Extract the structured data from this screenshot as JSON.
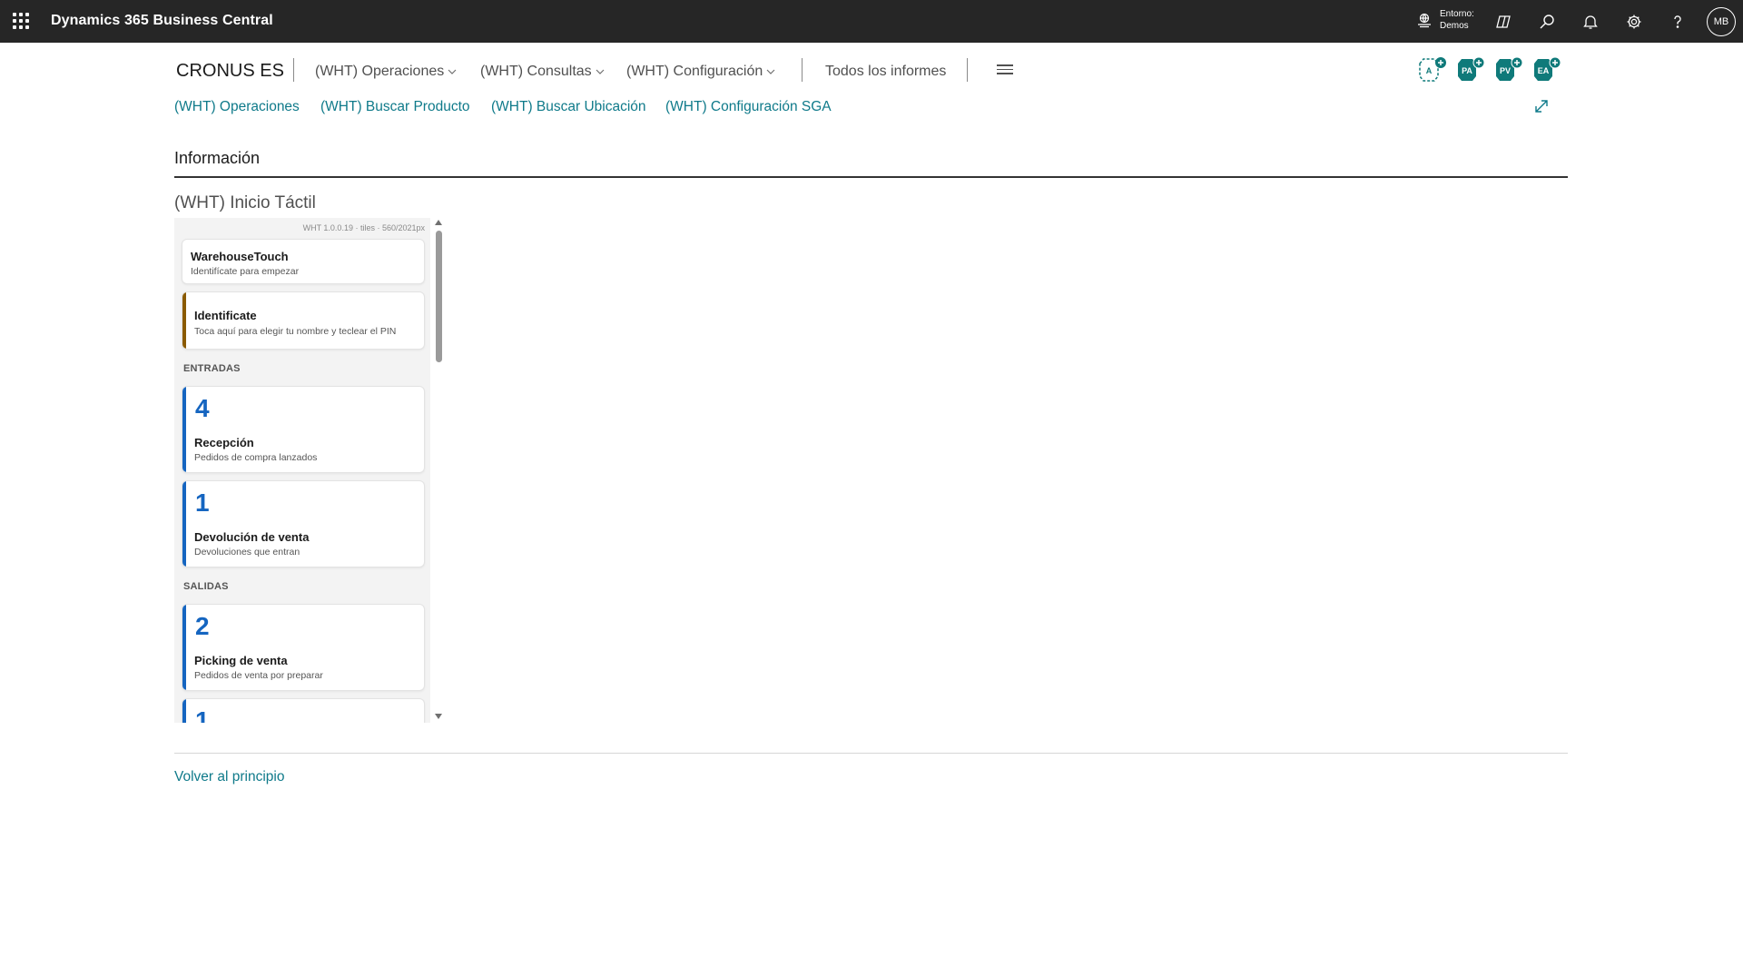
{
  "topbar": {
    "app_title": "Dynamics 365 Business Central",
    "env_label": "Entorno:",
    "env_value": "Demos",
    "avatar_initials": "MB"
  },
  "nav": {
    "company": "CRONUS ES",
    "menus": [
      "(WHT) Operaciones",
      "(WHT) Consultas",
      "(WHT) Configuración"
    ],
    "all_reports": "Todos los informes"
  },
  "quick_links": [
    "(WHT) Operaciones",
    "(WHT) Buscar Producto",
    "(WHT) Buscar Ubicación",
    "(WHT) Configuración SGA"
  ],
  "badges": [
    "A",
    "PA",
    "PV",
    "EA"
  ],
  "section": {
    "title": "Información",
    "part_title": "(WHT) Inicio Táctil"
  },
  "touch": {
    "version": "WHT 1.0.0.19 · tiles · 560/2021px",
    "welcome_title": "WarehouseTouch",
    "welcome_sub": "Identifícate para empezar",
    "identify_title": "Identificate",
    "identify_sub": "Toca aquí para elegir tu nombre y teclear el PIN",
    "group_in": "ENTRADAS",
    "group_out": "SALIDAS",
    "tiles": [
      {
        "count": "4",
        "title": "Recepción",
        "sub": "Pedidos de compra lanzados"
      },
      {
        "count": "1",
        "title": "Devolución de venta",
        "sub": "Devoluciones que entran"
      },
      {
        "count": "2",
        "title": "Picking de venta",
        "sub": "Pedidos de venta por preparar"
      },
      {
        "count": "1",
        "title": "",
        "sub": ""
      }
    ]
  },
  "footer": {
    "back_to_top": "Volver al principio"
  },
  "colors": {
    "topbar": "#262626",
    "link": "#0f7a8a",
    "tile_accent": "#1565c0",
    "identify_accent": "#8a5a00",
    "badge": "#0f7a7a"
  }
}
